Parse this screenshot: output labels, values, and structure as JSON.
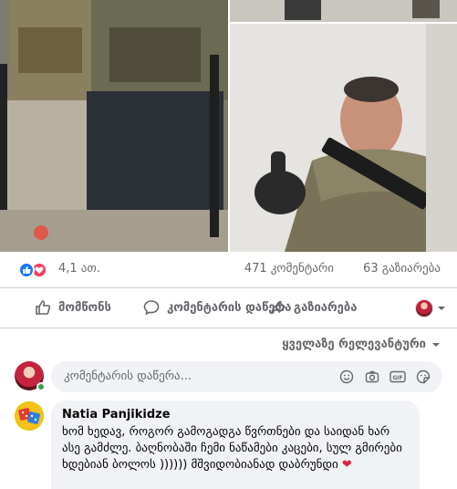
{
  "reactions": {
    "icons": [
      "like-icon",
      "love-icon"
    ],
    "count": "4,1 ათ.",
    "comments": "471 კომენტარი",
    "shares": "63 გაზიარება"
  },
  "actions": {
    "like_label": "მომწონს",
    "comment_label": "კომენტარის დაწერა",
    "share_label": "გაზიარება"
  },
  "filter": {
    "label": "ყველაზე რელევანტური"
  },
  "comment_input": {
    "placeholder": "კომენტარის დაწერა..."
  },
  "comment": {
    "author": "Natia Panjikidze",
    "text": "ხომ ხედავ, როგორ გამოგადგა წვრთნები და საიდან ხარ ასე გამძლე. ბაღნობაში ჩემი ნაწამები კაცები, სულ გმირები ხდებიან ბოლოს )))))) მშვიდობიანად დაბრუნდი",
    "emoji": "❤"
  },
  "colors": {
    "like_blue": "#1877f2",
    "love_red": "#f33e58",
    "secondary_text": "#65676b",
    "bubble_bg": "#f0f2f5",
    "online_green": "#31a24c"
  }
}
